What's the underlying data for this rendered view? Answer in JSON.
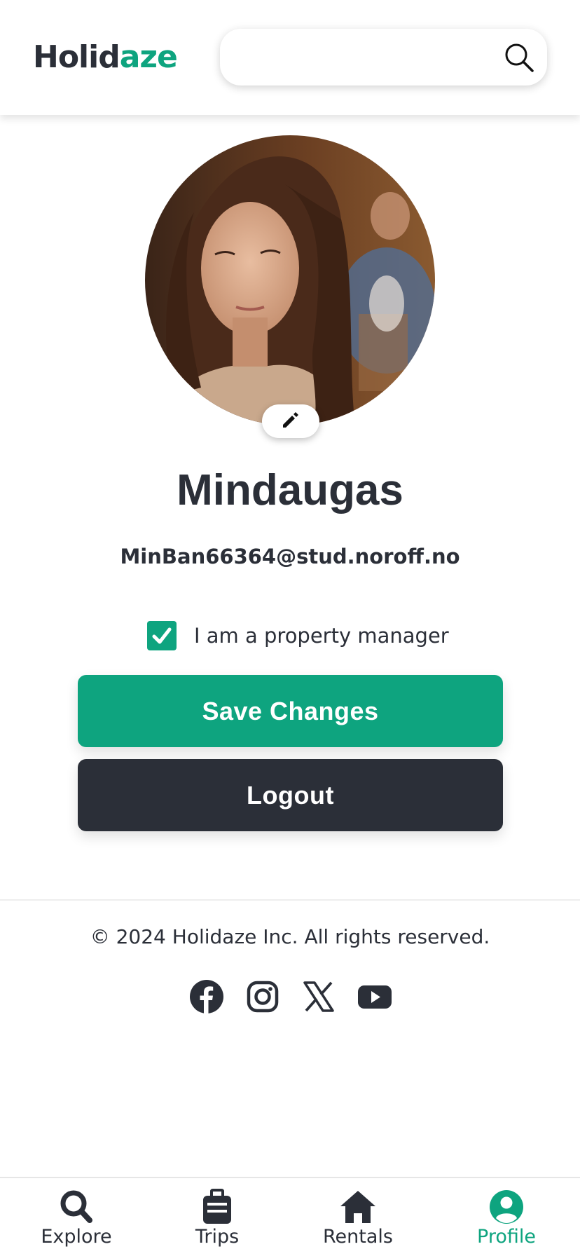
{
  "header": {
    "logo_part1": "Holid",
    "logo_part2": "aze",
    "search_placeholder": ""
  },
  "profile": {
    "name": "Mindaugas",
    "email": "MinBan66364@stud.noroff.no",
    "property_manager_label": "I am a property manager",
    "property_manager_checked": true
  },
  "actions": {
    "save_label": "Save Changes",
    "logout_label": "Logout"
  },
  "footer": {
    "copyright": "© 2024 Holidaze Inc. All rights reserved.",
    "socials": [
      "facebook-icon",
      "instagram-icon",
      "x-icon",
      "youtube-icon"
    ]
  },
  "nav": {
    "items": [
      {
        "label": "Explore",
        "icon": "search-icon"
      },
      {
        "label": "Trips",
        "icon": "suitcase-icon"
      },
      {
        "label": "Rentals",
        "icon": "home-icon"
      },
      {
        "label": "Profile",
        "icon": "user-circle-icon"
      }
    ],
    "active": "Profile"
  },
  "colors": {
    "accent": "#0ea47f",
    "dark": "#2b2f38",
    "background": "#ffffff"
  }
}
